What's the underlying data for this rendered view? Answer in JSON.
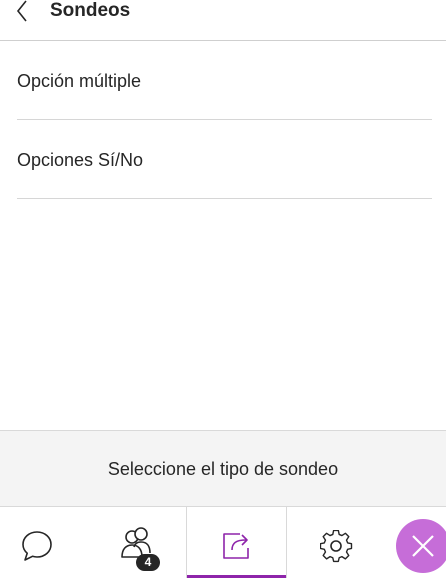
{
  "header": {
    "title": "Sondeos",
    "back_icon": "chevron-left-icon"
  },
  "options": [
    {
      "label": "Opción múltiple"
    },
    {
      "label": "Opciones Sí/No"
    }
  ],
  "footer": {
    "text": "Seleccione el tipo de sondeo"
  },
  "tabbar": {
    "tabs": [
      {
        "name": "chat",
        "icon": "chat-bubble-icon"
      },
      {
        "name": "attendees",
        "icon": "people-icon",
        "badge": "4"
      },
      {
        "name": "share-content",
        "icon": "share-icon",
        "active": true
      },
      {
        "name": "settings",
        "icon": "gear-icon"
      }
    ],
    "close_icon": "close-icon"
  },
  "colors": {
    "accent": "#8e24aa",
    "close_button": "#c66dd8",
    "footer_bg": "#f4f4f4",
    "divider": "#d6d6d6",
    "text": "#262626"
  }
}
